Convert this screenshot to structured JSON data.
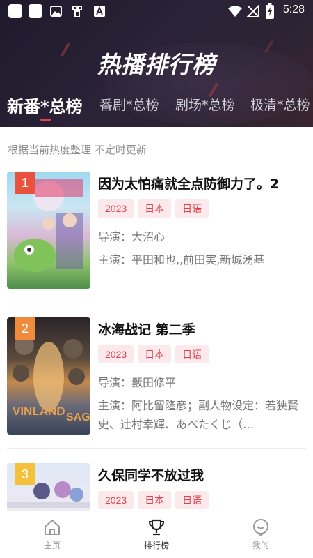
{
  "status_bar": {
    "time": "5:28",
    "left_icons": [
      "app-icon",
      "app-icon",
      "image-icon",
      "gamepad-icon",
      "a-icon"
    ],
    "right_icons": [
      "wifi-icon",
      "signal-icon",
      "battery-icon"
    ]
  },
  "header": {
    "title": "热播排行榜",
    "tabs": [
      {
        "label": "新番*总榜",
        "active": true
      },
      {
        "label": "番剧*总榜",
        "active": false
      },
      {
        "label": "剧场*总榜",
        "active": false
      },
      {
        "label": "极清*总榜",
        "active": false
      }
    ]
  },
  "list": {
    "subtitle": "根据当前热度整理 不定时更新",
    "items": [
      {
        "rank": "1",
        "rank_color": "#e8523f",
        "name": "因为太怕痛就全点防御力了。2",
        "tags": [
          "2023",
          "日本",
          "日语"
        ],
        "director": "导演：大沼心",
        "cast": "主演：平田和也,,前田実,新城湧基"
      },
      {
        "rank": "2",
        "rank_color": "#f08a3c",
        "name": "冰海战记 第二季",
        "tags": [
          "2023",
          "日本",
          "日语"
        ],
        "director": "导演：籔田修平",
        "cast": "主演：阿比留隆彦；副人物设定：若狭賢史、辻村幸輝、あべたくじ（…"
      },
      {
        "rank": "3",
        "rank_color": "#f4c13a",
        "name": "久保同学不放过我",
        "tags": [
          "2023",
          "日本",
          "日语"
        ],
        "director": "",
        "cast": ""
      }
    ]
  },
  "bottom_nav": {
    "items": [
      {
        "label": "主页",
        "icon": "home-icon",
        "active": false
      },
      {
        "label": "排行榜",
        "icon": "trophy-icon",
        "active": true
      },
      {
        "label": "我的",
        "icon": "profile-icon",
        "active": false
      }
    ]
  },
  "colors": {
    "accent": "#e8404f",
    "tag_bg": "#fbe9eb",
    "header_bg": "#241f30"
  }
}
